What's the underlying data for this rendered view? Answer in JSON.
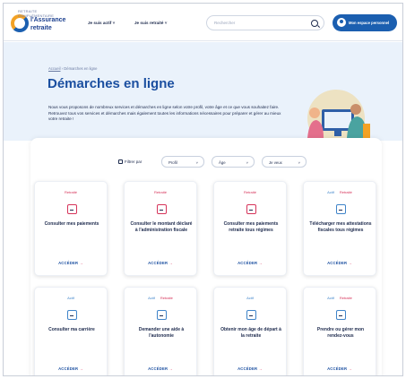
{
  "header": {
    "logo_small": "RETRAITE COMPLÉMENTAIRE",
    "logo_line1": "l'Assurance",
    "logo_line2": "retraite",
    "nav1": "Je suis actif ˅",
    "nav2": "Je suis retraité ˅",
    "search_placeholder": "Rechercher",
    "account_label": "Mon espace personnel"
  },
  "hero": {
    "breadcrumb_home": "Accueil",
    "breadcrumb_sep": " › ",
    "breadcrumb_current": "Démarches en ligne",
    "title": "Démarches en ligne",
    "description": "Nous vous proposons de nombreux services et démarches en ligne selon votre profil, votre âge et ce que vous souhaitez faire. Retrouvez tous vos services et démarches mais également toutes les informations nécessaires pour préparer et gérer au mieux votre retraite !"
  },
  "filters": {
    "label": "Filtrer par",
    "options": [
      "Profil",
      "Âge",
      "Je veux"
    ]
  },
  "cards": [
    {
      "tags": [
        {
          "text": "Retraité",
          "color": "red"
        }
      ],
      "icon": "document-icon",
      "title": "Consulter mes paiements",
      "cta": "ACCÉDER"
    },
    {
      "tags": [
        {
          "text": "Retraité",
          "color": "red"
        }
      ],
      "icon": "tax-icon",
      "title": "Consulter le montant déclaré à l'administration fiscale",
      "cta": "ACCÉDER"
    },
    {
      "tags": [
        {
          "text": "Retraité",
          "color": "red"
        }
      ],
      "icon": "calendar-icon",
      "title": "Consulter mes paiements retraite tous régimes",
      "cta": "ACCÉDER"
    },
    {
      "tags": [
        {
          "text": "Actif",
          "color": "blue"
        },
        {
          "text": "Retraité",
          "color": "red"
        }
      ],
      "icon": "download-icon",
      "title": "Télécharger mes attestations fiscales tous régimes",
      "cta": "ACCÉDER"
    },
    {
      "tags": [
        {
          "text": "Actif",
          "color": "blue"
        }
      ],
      "icon": "career-icon",
      "title": "Consulter ma carrière",
      "cta": "ACCÉDER"
    },
    {
      "tags": [
        {
          "text": "Actif",
          "color": "blue"
        },
        {
          "text": "Retraité",
          "color": "red"
        }
      ],
      "icon": "request-icon",
      "title": "Demander une aide à l'autonomie",
      "cta": "ACCÉDER"
    },
    {
      "tags": [
        {
          "text": "Actif",
          "color": "blue"
        }
      ],
      "icon": "age-icon",
      "title": "Obtenir mon âge de départ à la retraite",
      "cta": "ACCÉDER"
    },
    {
      "tags": [
        {
          "text": "Actif",
          "color": "blue"
        },
        {
          "text": "Retraité",
          "color": "red"
        }
      ],
      "icon": "id-card-icon",
      "title": "Prendre ou gérer mon rendez-vous",
      "cta": "ACCÉDER"
    }
  ],
  "colors": {
    "brand_blue": "#1b5fb0",
    "tag_red": "#d6335a",
    "tag_blue": "#3f84c9",
    "hero_bg": "#eaf2fb"
  }
}
